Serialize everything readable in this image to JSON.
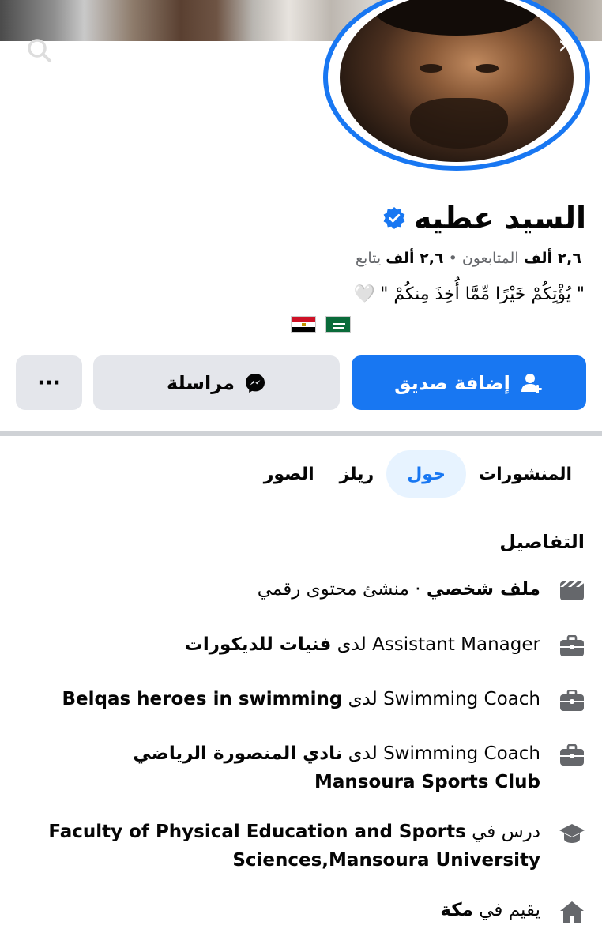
{
  "profile": {
    "name": "السيد عطيه",
    "stats": {
      "followers_count": "٢,٦ ألف",
      "followers_label": "المتابعون",
      "separator": "•",
      "following_count": "٢,٦ ألف",
      "following_label": "يتابع"
    },
    "bio": "\" يُؤْتِكُمْ خَيْرًا مِّمَّا أُخِذَ مِنكُمْ \"",
    "bio_emoji": "🤍"
  },
  "actions": {
    "add_friend": "إضافة صديق",
    "message": "مراسلة",
    "more": "···"
  },
  "tabs": [
    {
      "label": "المنشورات",
      "active": false
    },
    {
      "label": "حول",
      "active": true
    },
    {
      "label": "ريلز",
      "active": false
    },
    {
      "label": "الصور",
      "active": false
    }
  ],
  "details": {
    "title": "التفاصيل",
    "items": [
      {
        "icon": "page-icon",
        "bold": "ملف شخصي",
        "text": " · منشئ محتوى رقمي"
      },
      {
        "icon": "briefcase-icon",
        "role": "Assistant Manager",
        "prep": " لدى ",
        "org": "فنيات للديكورات"
      },
      {
        "icon": "briefcase-icon",
        "role": "Swimming Coach",
        "prep": " لدى ",
        "org": "Belqas heroes in swimming"
      },
      {
        "icon": "briefcase-icon",
        "role": "Swimming Coach",
        "prep": " لدى ",
        "org": "نادي المنصورة الرياضي",
        "org2": "Mansoura Sports Club"
      },
      {
        "icon": "graduation-cap-icon",
        "prefix": "درس في ",
        "org": "Faculty of Physical Education and Sports",
        "org2": "Sciences,Mansoura University"
      },
      {
        "icon": "home-icon",
        "prefix": "يقيم في ",
        "org": "مكة"
      }
    ]
  },
  "colors": {
    "accent": "#1877f2",
    "button_secondary": "#e4e6eb",
    "icon": "#65676b"
  }
}
